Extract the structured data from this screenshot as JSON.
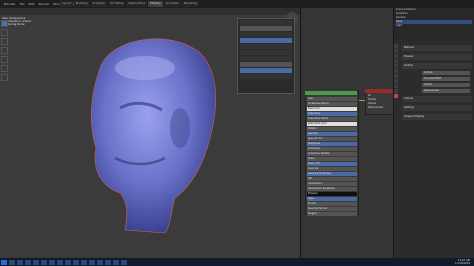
{
  "app": {
    "menu": [
      "Blender",
      "File",
      "Edit",
      "Render",
      "Window",
      "Help"
    ],
    "workspaces": [
      "Layout",
      "Modeling",
      "Sculpting",
      "UV Editing",
      "Texture Paint",
      "Shading",
      "Animation",
      "Rendering",
      "Compositing",
      "Scripting"
    ],
    "active_workspace_index": 5
  },
  "viewport": {
    "info_lines": [
      "User Perspective",
      "(1) Collection | Head",
      "Rendering Done"
    ]
  },
  "node_editor": {
    "bsdf_title": "Principled BSDF",
    "output_title": "Material Output",
    "output_rows": [
      "All",
      "Surface",
      "Volume",
      "Displacement"
    ],
    "bsdf_rows": [
      "GGX",
      "Christensen-Burley",
      "Base Color",
      "Subsurface",
      "Subsurface Radius",
      "Subsurface Color",
      "Metallic",
      "Specular",
      "Specular Tint",
      "Roughness",
      "Anisotropic",
      "Anisotropic Rotation",
      "Sheen",
      "Sheen Tint",
      "Clearcoat",
      "Clearcoat Roughness",
      "IOR",
      "Transmission",
      "Transmission Roughness",
      "Emission",
      "Alpha",
      "Normal",
      "Clearcoat Normal",
      "Tangent"
    ]
  },
  "outliner": {
    "rows": [
      "Scene Collection",
      "Collection",
      "Camera",
      "Head",
      "Light"
    ],
    "selected_index": 3
  },
  "properties": {
    "panels": [
      "Material",
      "Preview",
      "Surface",
      "Volume",
      "Settings",
      "Viewport Display"
    ],
    "fields": [
      "Surface",
      "Principled BSDF",
      "Volume",
      "Displacement"
    ]
  },
  "status": {
    "time": "11:07 AM",
    "date": "11/20/2019"
  },
  "colors": {
    "bsdf_header": "#4b9b4b",
    "output_header": "#9a2a2a",
    "accent": "#4772b3",
    "mesh": "#8088d8"
  },
  "icons": [
    "select-icon",
    "move-icon",
    "rotate-icon",
    "scale-icon",
    "transform-icon",
    "annotate-icon",
    "measure-icon"
  ]
}
